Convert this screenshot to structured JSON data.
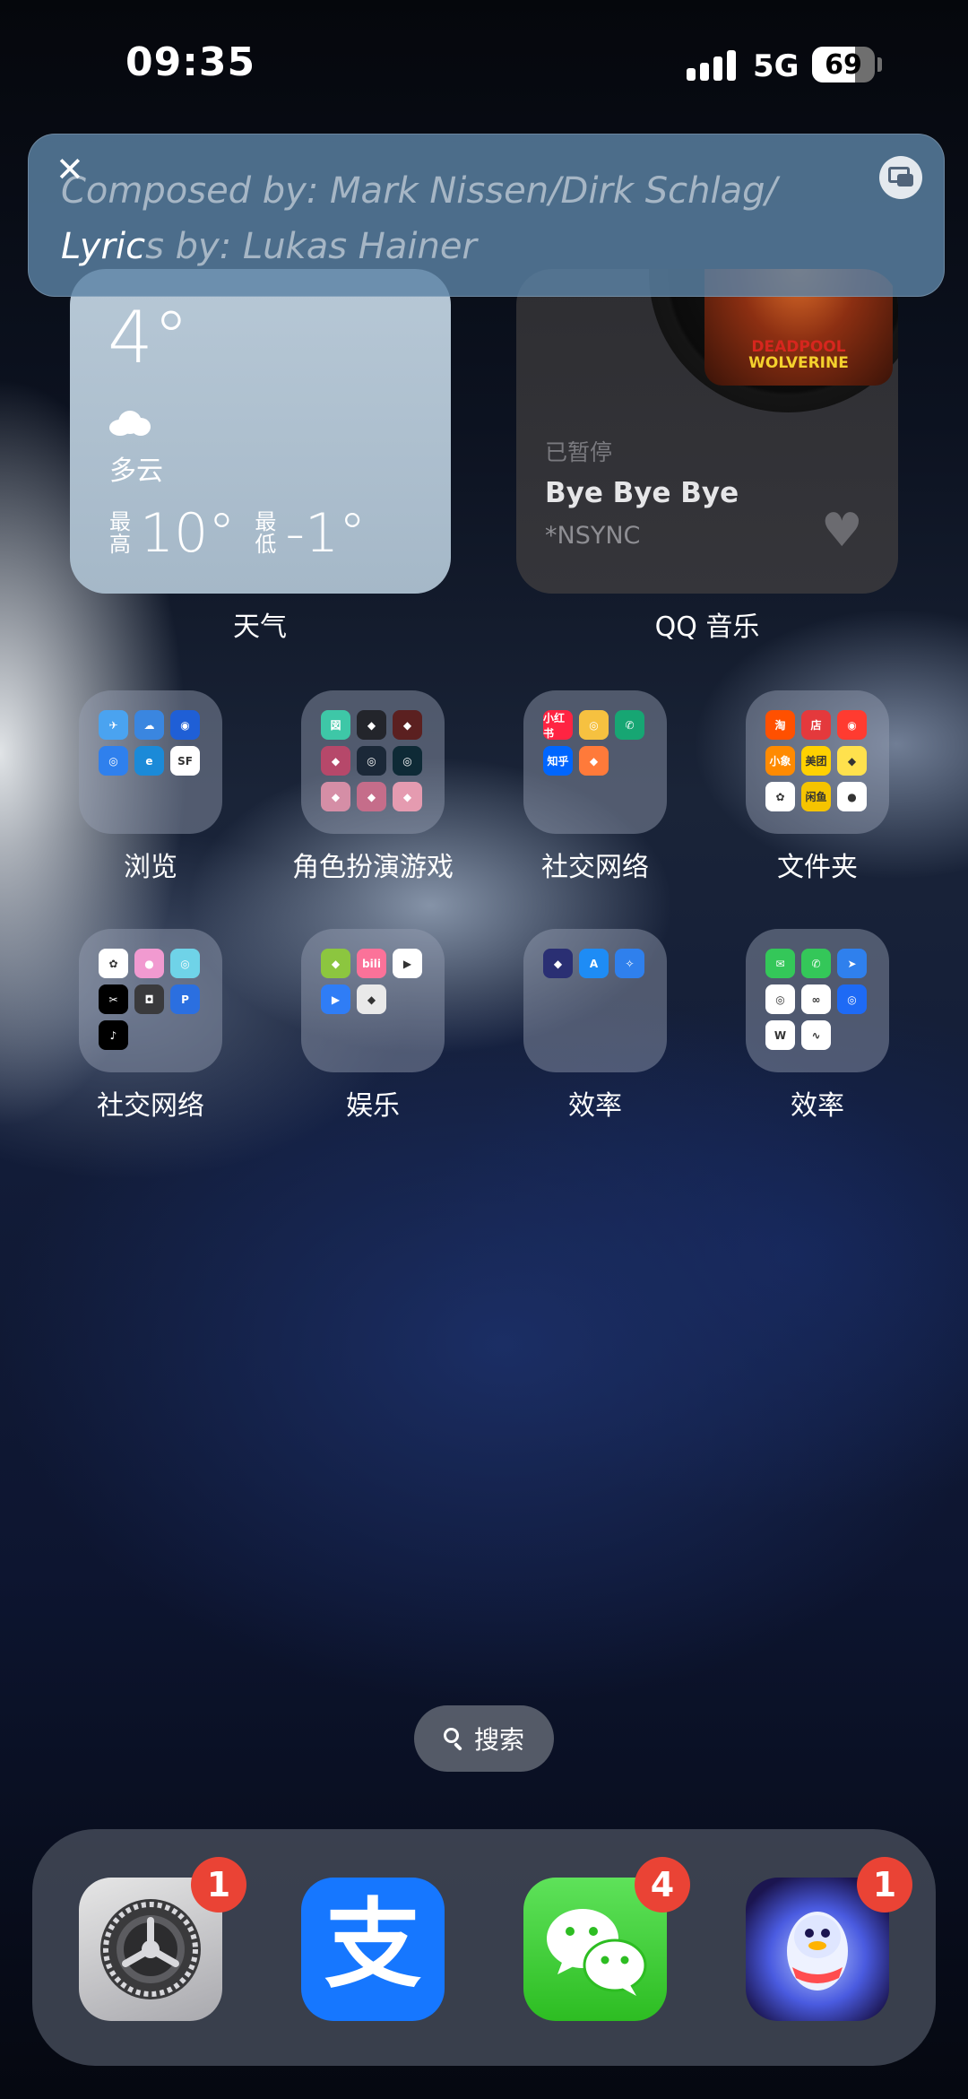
{
  "status_bar": {
    "time": "09:35",
    "network": "5G",
    "battery_level": "69"
  },
  "lyrics_banner": {
    "close_glyph": "✕",
    "line1": "Composed by:  Mark Nissen/Dirk Schlag/",
    "line2_highlight": "Lyric",
    "line2_rest": "s by:  Lukas Hainer"
  },
  "weather_widget": {
    "temperature": "4°",
    "condition": "多云",
    "high_label": "最高",
    "high_value": "10°",
    "low_label": "最低",
    "low_value": "-1°",
    "caption": "天气"
  },
  "music_widget": {
    "album_text_top": "DEADPOOL",
    "album_text_bottom": "WOLVERINE",
    "status": "已暂停",
    "song": "Bye Bye Bye",
    "artist": "*NSYNC",
    "caption": "QQ 音乐"
  },
  "folders": [
    {
      "label": "浏览",
      "apps": [
        {
          "icon": "plane-icon",
          "color": "#4aa3f0",
          "text": "✈"
        },
        {
          "icon": "weather-icon",
          "color": "#3a86e0",
          "text": "☁"
        },
        {
          "icon": "browser-icon",
          "color": "#1f5fd6",
          "text": "◉"
        },
        {
          "icon": "compass-icon",
          "color": "#2f80ed",
          "text": "◎"
        },
        {
          "icon": "edge-icon",
          "color": "#1b8ad8",
          "text": "e"
        },
        {
          "icon": "sf-express-icon",
          "color": "#ffffff",
          "text": "SF"
        }
      ]
    },
    {
      "label": "角色扮演游戏",
      "apps": [
        {
          "icon": "game-icon",
          "color": "#3ec7a7",
          "text": "図"
        },
        {
          "icon": "game-icon",
          "color": "#23252b",
          "text": "◆"
        },
        {
          "icon": "game-icon",
          "color": "#5b2020",
          "text": "◆"
        },
        {
          "icon": "game-icon",
          "color": "#b6486a",
          "text": "◆"
        },
        {
          "icon": "steam-icon",
          "color": "#1b2838",
          "text": "◎"
        },
        {
          "icon": "game-icon",
          "color": "#0e2a36",
          "text": "◎"
        },
        {
          "icon": "game-icon",
          "color": "#d58ea6",
          "text": "◆"
        },
        {
          "icon": "game-icon",
          "color": "#c56d8a",
          "text": "◆"
        },
        {
          "icon": "game-icon",
          "color": "#e59bb0",
          "text": "◆"
        }
      ]
    },
    {
      "label": "社交网络",
      "apps": [
        {
          "icon": "xiaohongshu-icon",
          "color": "#ff2442",
          "text": "小红书"
        },
        {
          "icon": "weibo-icon",
          "color": "#f6c140",
          "text": "◎"
        },
        {
          "icon": "phone-icon",
          "color": "#17a673",
          "text": "✆"
        },
        {
          "icon": "zhihu-icon",
          "color": "#0066ff",
          "text": "知乎"
        },
        {
          "icon": "gift-icon",
          "color": "#ff7a3a",
          "text": "◆"
        }
      ]
    },
    {
      "label": "文件夹",
      "apps": [
        {
          "icon": "taobao-icon",
          "color": "#ff5000",
          "text": "淘"
        },
        {
          "icon": "store-icon",
          "color": "#e4393c",
          "text": "店"
        },
        {
          "icon": "app-icon",
          "color": "#ff3b30",
          "text": "◉"
        },
        {
          "icon": "app-icon",
          "color": "#ff8a00",
          "text": "小象"
        },
        {
          "icon": "meituan-icon",
          "color": "#ffd100",
          "text": "美团"
        },
        {
          "icon": "app-icon",
          "color": "#ffe14d",
          "text": "◆"
        },
        {
          "icon": "photos-icon",
          "color": "#ffffff",
          "text": "✿"
        },
        {
          "icon": "app-icon",
          "color": "#f5c400",
          "text": "闲鱼"
        },
        {
          "icon": "app-icon",
          "color": "#ffffff",
          "text": "●"
        }
      ]
    },
    {
      "label": "社交网络",
      "apps": [
        {
          "icon": "photos-icon",
          "color": "#ffffff",
          "text": "✿"
        },
        {
          "icon": "app-icon",
          "color": "#f19ad0",
          "text": "●"
        },
        {
          "icon": "app-icon",
          "color": "#6fd3e8",
          "text": "◎"
        },
        {
          "icon": "capcut-icon",
          "color": "#000000",
          "text": "✂"
        },
        {
          "icon": "camera-icon",
          "color": "#3a3a3c",
          "text": "◘"
        },
        {
          "icon": "app-icon",
          "color": "#2b6fe0",
          "text": "P"
        },
        {
          "icon": "tiktok-icon",
          "color": "#000000",
          "text": "♪"
        }
      ]
    },
    {
      "label": "娱乐",
      "apps": [
        {
          "icon": "app-icon",
          "color": "#8cc63f",
          "text": "◆"
        },
        {
          "icon": "bilibili-icon",
          "color": "#fb7299",
          "text": "bili"
        },
        {
          "icon": "video-icon",
          "color": "#ffffff",
          "text": "▶"
        },
        {
          "icon": "play-icon",
          "color": "#2f7df6",
          "text": "▶"
        },
        {
          "icon": "app-icon",
          "color": "#e9e9e9",
          "text": "◆"
        }
      ]
    },
    {
      "label": "效率",
      "apps": [
        {
          "icon": "app-icon",
          "color": "#2a2f73",
          "text": "◆"
        },
        {
          "icon": "app-store-icon",
          "color": "#1e8cf5",
          "text": "A"
        },
        {
          "icon": "safari-icon",
          "color": "#2f80ed",
          "text": "✧"
        }
      ]
    },
    {
      "label": "效率",
      "apps": [
        {
          "icon": "messages-icon",
          "color": "#34c759",
          "text": "✉"
        },
        {
          "icon": "phone-icon",
          "color": "#34c759",
          "text": "✆"
        },
        {
          "icon": "app-icon",
          "color": "#2f80ed",
          "text": "➤"
        },
        {
          "icon": "app-icon",
          "color": "#ffffff",
          "text": "◎"
        },
        {
          "icon": "app-icon",
          "color": "#ffffff",
          "text": "∞"
        },
        {
          "icon": "app-icon",
          "color": "#1e6af5",
          "text": "◎"
        },
        {
          "icon": "wps-icon",
          "color": "#ffffff",
          "text": "W"
        },
        {
          "icon": "health-icon",
          "color": "#ffffff",
          "text": "∿"
        }
      ]
    }
  ],
  "search": {
    "label": "搜索"
  },
  "dock": {
    "apps": [
      {
        "name": "settings",
        "icon": "gear-icon",
        "badge": "1"
      },
      {
        "name": "alipay",
        "icon": "alipay-icon",
        "glyph": "支",
        "badge": ""
      },
      {
        "name": "wechat",
        "icon": "wechat-icon",
        "badge": "4"
      },
      {
        "name": "qq",
        "icon": "qq-icon",
        "badge": "1"
      }
    ]
  },
  "colors": {
    "badge": "#ea4335",
    "alipay": "#1677ff",
    "wechat": "#2dc100"
  }
}
